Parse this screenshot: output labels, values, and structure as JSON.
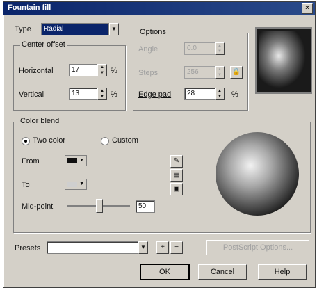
{
  "window": {
    "title": "Fountain fill",
    "close_glyph": "×"
  },
  "type_section": {
    "label": "Type",
    "value": "Radial"
  },
  "center_offset": {
    "label": "Center offset",
    "horizontal_label": "Horizontal",
    "horizontal_value": "17",
    "vertical_label": "Vertical",
    "vertical_value": "13",
    "unit": "%"
  },
  "options": {
    "label": "Options",
    "angle_label": "Angle",
    "angle_value": "0.0",
    "steps_label": "Steps",
    "steps_value": "256",
    "edge_pad_label": "Edge pad",
    "edge_pad_value": "28",
    "unit": "%"
  },
  "color_blend": {
    "label": "Color blend",
    "two_color_label": "Two color",
    "custom_label": "Custom",
    "from_label": "From",
    "to_label": "To",
    "midpoint_label": "Mid-point",
    "midpoint_value": "50",
    "midpoint_fraction": 0.5,
    "from_color": "#111111",
    "to_color": "#cfcfcf"
  },
  "presets": {
    "label": "Presets",
    "value": "",
    "add_glyph": "+",
    "remove_glyph": "−",
    "postscript_label": "PostScript Options..."
  },
  "buttons": {
    "ok": "OK",
    "cancel": "Cancel",
    "help": "Help"
  }
}
